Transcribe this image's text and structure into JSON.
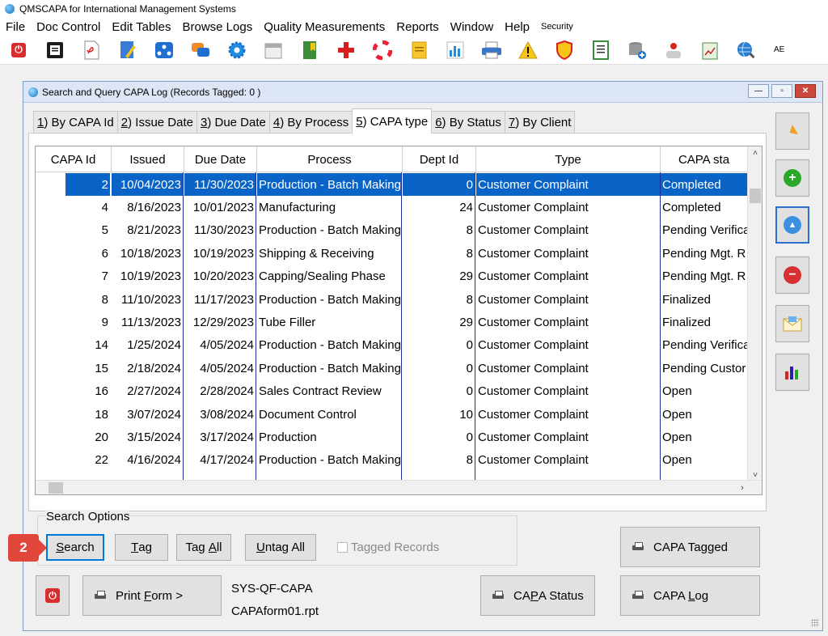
{
  "app": {
    "title": "QMSCAPA for International Management Systems"
  },
  "menu": [
    "File",
    "Doc Control",
    "Edit Tables",
    "Browse Logs",
    "Quality Measurements",
    "Reports",
    "Window",
    "Help"
  ],
  "menu_small": "Security",
  "toolbar": {
    "icons": [
      "power-icon",
      "document-list-icon",
      "pdf-document-icon",
      "edit-document-icon",
      "org-chart-icon",
      "chat-bubbles-icon",
      "settings-gear-icon",
      "calendar-icon",
      "book-bookmark-icon",
      "medical-cross-icon",
      "lifebuoy-icon",
      "notepad-icon",
      "bar-chart-icon",
      "printer-icon",
      "warning-triangle-icon",
      "shield-icon",
      "checklist-icon",
      "database-add-icon",
      "user-admin-icon",
      "clipboard-chart-icon",
      "globe-search-icon"
    ],
    "overflow_text": "AE"
  },
  "window": {
    "title": "Search and Query CAPA Log  (Records Tagged:  0 )",
    "controls": {
      "minimize": "—",
      "restore": "▫",
      "close": "✕"
    }
  },
  "tabs": [
    {
      "key": "1",
      "label": ") By CAPA Id"
    },
    {
      "key": "2",
      "label": ") Issue Date"
    },
    {
      "key": "3",
      "label": ") Due Date"
    },
    {
      "key": "4",
      "label": ") By Process"
    },
    {
      "key": "5",
      "label": ") CAPA type"
    },
    {
      "key": "6",
      "label": ") By Status"
    },
    {
      "key": "7",
      "label": ") By Client"
    }
  ],
  "active_tab": 4,
  "grid": {
    "columns": [
      "CAPA Id",
      "Issued",
      "Due Date",
      "Process",
      "Dept Id",
      "Type",
      "CAPA sta"
    ],
    "rows": [
      [
        "2",
        "10/04/2023",
        "11/30/2023",
        "Production - Batch Making",
        "0",
        "Customer Complaint",
        "Completed"
      ],
      [
        "4",
        "8/16/2023",
        "10/01/2023",
        "Manufacturing",
        "24",
        "Customer Complaint",
        "Completed"
      ],
      [
        "5",
        "8/21/2023",
        "11/30/2023",
        "Production - Batch Making",
        "8",
        "Customer Complaint",
        "Pending Verifica"
      ],
      [
        "6",
        "10/18/2023",
        "10/19/2023",
        "Shipping & Receiving",
        "8",
        "Customer Complaint",
        "Pending Mgt. R"
      ],
      [
        "7",
        "10/19/2023",
        "10/20/2023",
        "Capping/Sealing Phase",
        "29",
        "Customer Complaint",
        "Pending Mgt. R"
      ],
      [
        "8",
        "11/10/2023",
        "11/17/2023",
        "Production - Batch Making",
        "8",
        "Customer Complaint",
        "Finalized"
      ],
      [
        "9",
        "11/13/2023",
        "12/29/2023",
        "Tube Filler",
        "29",
        "Customer Complaint",
        "Finalized"
      ],
      [
        "14",
        "1/25/2024",
        "4/05/2024",
        "Production - Batch Making",
        "0",
        "Customer Complaint",
        "Pending Verifica"
      ],
      [
        "15",
        "2/18/2024",
        "4/05/2024",
        "Production - Batch Making",
        "0",
        "Customer Complaint",
        "Pending Custor"
      ],
      [
        "16",
        "2/27/2024",
        "2/28/2024",
        "Sales Contract Review",
        "0",
        "Customer Complaint",
        "Open"
      ],
      [
        "18",
        "3/07/2024",
        "3/08/2024",
        "Document Control",
        "10",
        "Customer Complaint",
        "Open"
      ],
      [
        "20",
        "3/15/2024",
        "3/17/2024",
        "Production",
        "0",
        "Customer Complaint",
        "Open"
      ],
      [
        "22",
        "4/16/2024",
        "4/17/2024",
        "Production - Batch Making",
        "8",
        "Customer Complaint",
        "Open"
      ]
    ],
    "selected_row": 0,
    "scroll_up": "˄",
    "scroll_down": "˅",
    "scroll_left": "‹",
    "scroll_right": "›"
  },
  "side_buttons": [
    "arrow-back-icon",
    "add-icon",
    "up-triangle-icon",
    "delete-icon",
    "email-icon",
    "bar-chart-icon"
  ],
  "search_options": {
    "label": "Search Options",
    "search": {
      "first": "S",
      "rest": "earch"
    },
    "tag": {
      "first": "T",
      "rest": "ag"
    },
    "tag_all": {
      "pre": "Tag ",
      "first": "A",
      "rest": "ll"
    },
    "untag_all": {
      "first": "U",
      "rest": "ntag All"
    },
    "tagged_records": "Tagged Records"
  },
  "buttons": {
    "capa_tagged": "CAPA Tagged",
    "capa_status_pre": "CA",
    "capa_status_u": "P",
    "capa_status_post": "A Status",
    "capa_log_pre": "CAPA ",
    "capa_log_u": "L",
    "capa_log_post": "og",
    "print_form_pre": "Print ",
    "print_form_u": "F",
    "print_form_post": "orm >"
  },
  "form_info": {
    "code": "SYS-QF-CAPA",
    "report": "CAPAform01.rpt"
  },
  "callout": "2"
}
